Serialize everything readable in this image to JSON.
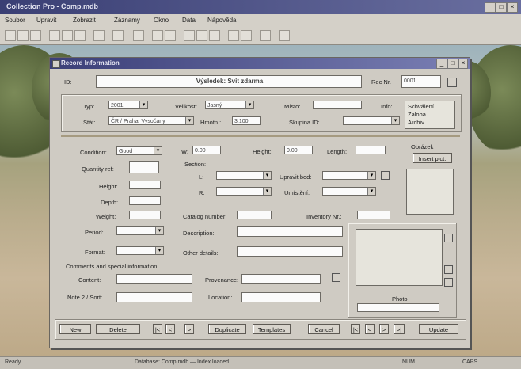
{
  "app": {
    "title": "Collection Pro - Comp.mdb"
  },
  "window_controls": {
    "minimize": "_",
    "maximize": "□",
    "close": "×"
  },
  "menu": [
    "Soubor",
    "Upravit",
    "Zobrazit",
    "Záznamy",
    "Okno",
    "Data",
    "Nápověda"
  ],
  "dialog": {
    "title": "Record Information",
    "name_field": "Výsledek: Svit zdarma",
    "record_label": "Rec Nr.",
    "record_value": "0001",
    "row1": {
      "type_label": "Typ:",
      "type_value": "2001",
      "size_label": "Velikost:",
      "size_value": "Jasný",
      "place_label": "Místo:",
      "place_value": "",
      "extra_label": "Info:"
    },
    "row2": {
      "land_label": "Stát:",
      "land_value": "ČR / Praha, Vysočany",
      "weight_label": "Hmotn.:",
      "weight_value": "3.100",
      "group_label": "Skupina ID:",
      "group_value": ""
    },
    "checklist": [
      "Schválení",
      "Záloha",
      "Archiv"
    ],
    "col1": {
      "condition_label": "Condition:",
      "condition_value": "Good",
      "quantity_label": "Quantity ref:",
      "quantity_value": "",
      "height_label": "Height:",
      "width_label": "Depth:",
      "length_label": "Weight:",
      "period_label": "Period:",
      "format_label": "Format:"
    },
    "dims": {
      "w_label": "W:",
      "w_value": "0.00",
      "h_label": "Height:",
      "h_value": "0.00",
      "l_label": "Length:",
      "l_value": ""
    },
    "picture_label": "Obrázek",
    "picture_button": "Insert pict.",
    "section_label": "Section:",
    "l_label": "L:",
    "r_label": "R:",
    "unit1_label": "Upravit bod:",
    "unit2_label": "Umístění:",
    "catalog_label": "Catalog number:",
    "catalog_value": "",
    "desc_label": "Description:",
    "desc_value": "",
    "other_label": "Other details:",
    "other_value": "",
    "inventory_label": "Inventory Nr.:",
    "inventory_value": "",
    "comments_label": "Comments and special information",
    "c1_label": "Content:",
    "c2_label": "Note 2 / Sort:",
    "catalog2_label": "Provenance:",
    "location_label": "Location:",
    "photo_label": "Photo",
    "buttons": {
      "new": "New",
      "delete": "Delete",
      "first": "|<",
      "prev": "<",
      "next": ">",
      "duplicate": "Duplicate",
      "templates": "Templates",
      "cancel": "Cancel",
      "nav1": "|<",
      "nav2": "<",
      "nav3": ">",
      "nav4": ">|",
      "update": "Update"
    }
  },
  "status": {
    "left": "Ready",
    "middle": "Database: Comp.mdb — Index loaded",
    "right1": "NUM",
    "right2": "CAPS"
  },
  "colors": {
    "titlebar": "#3a3f74",
    "dialog": "#cfcbc3"
  }
}
